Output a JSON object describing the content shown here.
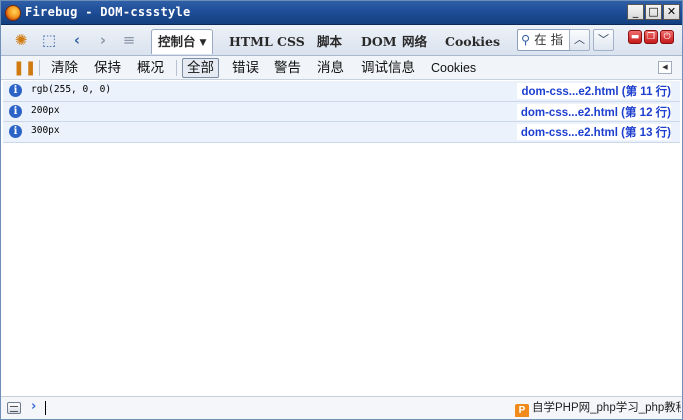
{
  "window": {
    "title": "Firebug - DOM-cssstyle",
    "minimize": "_",
    "maximize": "□",
    "close": "✕"
  },
  "toolbar": {
    "tabs": [
      {
        "label": "控制台",
        "active": true
      },
      {
        "label": "HTML"
      },
      {
        "label": "CSS"
      },
      {
        "label": "脚本"
      },
      {
        "label": "DOM"
      },
      {
        "label": "网络"
      },
      {
        "label": "Cookies"
      }
    ],
    "search_text": "在 指",
    "icons": [
      "firebug-icon",
      "inspect-icon",
      "back-icon",
      "forward-icon",
      "command-editor-icon"
    ]
  },
  "console_toolbar": {
    "clear": "清除",
    "persist": "保持",
    "profile": "概况",
    "filters": [
      "全部",
      "错误",
      "警告",
      "消息",
      "调试信息",
      "Cookies"
    ],
    "selected_filter": "全部"
  },
  "log": [
    {
      "message": "rgb(255, 0, 0)",
      "source": "dom-css...e2.html (第 11 行)"
    },
    {
      "message": "200px",
      "source": "dom-css...e2.html (第 12 行)"
    },
    {
      "message": "300px",
      "source": "dom-css...e2.html (第 13 行)"
    }
  ],
  "command_line": {
    "prompt": "›"
  },
  "watermark": {
    "logo": "P",
    "text": "自学PHP网_php学习_php教程"
  },
  "colors": {
    "titlebar": "#1e4c96",
    "row_background": "#ebf2fb",
    "link": "#1d3fcf",
    "info": "#2c63c6"
  }
}
